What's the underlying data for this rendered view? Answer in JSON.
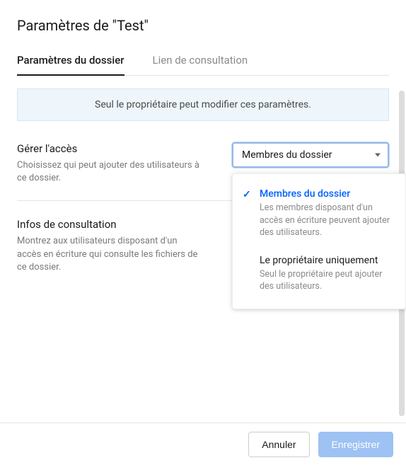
{
  "header": {
    "title": "Paramètres de \"Test\""
  },
  "tabs": {
    "items": [
      {
        "label": "Paramètres du dossier",
        "active": true
      },
      {
        "label": "Lien de consultation",
        "active": false
      }
    ]
  },
  "notice": "Seul le propriétaire peut modifier ces paramètres.",
  "sections": {
    "manage_access": {
      "title": "Gérer l'accès",
      "desc": "Choisissez qui peut ajouter des utilisateurs à ce dossier.",
      "select_value": "Membres du dossier",
      "options": [
        {
          "title": "Membres du dossier",
          "desc": "Les membres disposant d'un accès en écriture peuvent ajouter des utilisateurs.",
          "selected": true
        },
        {
          "title": "Le propriétaire uniquement",
          "desc": "Seul le propriétaire peut ajouter des utilisateurs.",
          "selected": false
        }
      ]
    },
    "view_info": {
      "title": "Infos de consultation",
      "desc": "Montrez aux utilisateurs disposant d'un accès en écriture qui consulte les fichiers de ce dossier."
    }
  },
  "footer": {
    "cancel": "Annuler",
    "save": "Enregistrer"
  }
}
